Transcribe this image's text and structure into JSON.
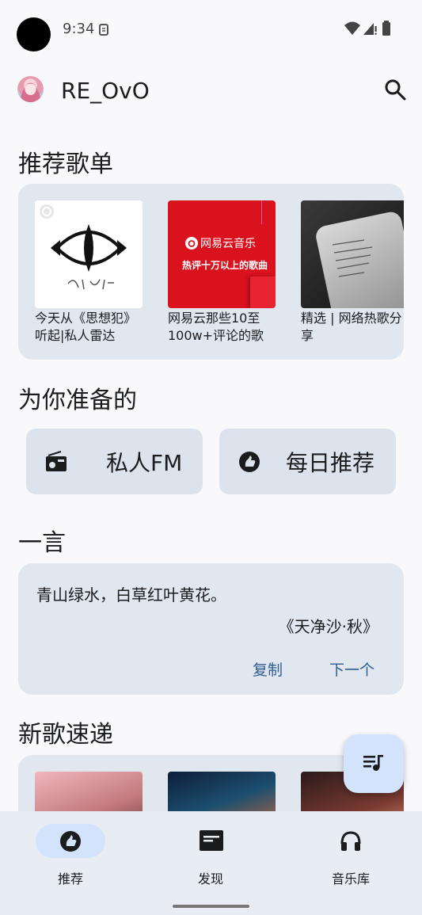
{
  "status_bar": {
    "time": "9:34"
  },
  "app_bar": {
    "username": "RE_OvO"
  },
  "recommended": {
    "title": "推荐歌单",
    "playlists": [
      {
        "name": "今天从《思想犯》听起|私人雷达"
      },
      {
        "name": "网易云那些10至100w+评论的歌",
        "cover_brand": "网易云音乐",
        "cover_caption": "热评十万以上的歌曲"
      },
      {
        "name": "精选 | 网络热歌分享"
      }
    ]
  },
  "for_you": {
    "title": "为你准备的",
    "buttons": [
      {
        "label": "私人FM",
        "icon": "radio-icon"
      },
      {
        "label": "每日推荐",
        "icon": "daily-recommend-icon"
      }
    ]
  },
  "quote": {
    "title": "一言",
    "text": "青山绿水，白草红叶黄花。",
    "source": "《天净沙·秋》",
    "copy_label": "复制",
    "next_label": "下一个"
  },
  "new_songs": {
    "title": "新歌速递"
  },
  "bottom_nav": {
    "items": [
      {
        "label": "推荐",
        "icon": "recommend-icon",
        "active": true
      },
      {
        "label": "发现",
        "icon": "discover-icon",
        "active": false
      },
      {
        "label": "音乐库",
        "icon": "headphones-icon",
        "active": false
      }
    ]
  },
  "colors": {
    "accent": "#2e5d8f",
    "card_bg": "#e1e7ef",
    "fab_bg": "#d3e3fb",
    "nav_active": "#d3e3fb"
  }
}
